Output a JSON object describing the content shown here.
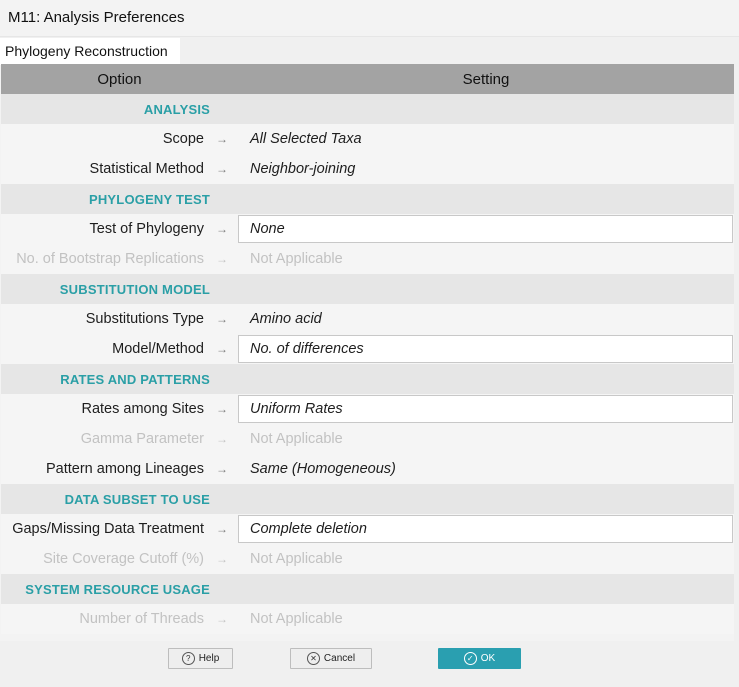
{
  "window": {
    "title": "M11: Analysis Preferences"
  },
  "tabs": [
    {
      "label": "Phylogeny Reconstruction"
    }
  ],
  "grid": {
    "header": {
      "option": "Option",
      "setting": "Setting"
    },
    "arrow_glyph": "→",
    "sections": [
      {
        "label": "ANALYSIS",
        "rows": [
          {
            "option": "Scope",
            "value": "All Selected Taxa",
            "enabled": true,
            "editable": false
          },
          {
            "option": "Statistical Method",
            "value": "Neighbor-joining",
            "enabled": true,
            "editable": false
          }
        ]
      },
      {
        "label": "PHYLOGENY TEST",
        "rows": [
          {
            "option": "Test of Phylogeny",
            "value": "None",
            "enabled": true,
            "editable": true
          },
          {
            "option": "No. of Bootstrap Replications",
            "value": "Not Applicable",
            "enabled": false,
            "editable": false
          }
        ]
      },
      {
        "label": "SUBSTITUTION MODEL",
        "rows": [
          {
            "option": "Substitutions Type",
            "value": "Amino acid",
            "enabled": true,
            "editable": false
          },
          {
            "option": "Model/Method",
            "value": "No. of differences",
            "enabled": true,
            "editable": true
          }
        ]
      },
      {
        "label": "RATES AND PATTERNS",
        "rows": [
          {
            "option": "Rates among Sites",
            "value": "Uniform Rates",
            "enabled": true,
            "editable": true
          },
          {
            "option": "Gamma Parameter",
            "value": "Not Applicable",
            "enabled": false,
            "editable": false
          },
          {
            "option": "Pattern among Lineages",
            "value": "Same (Homogeneous)",
            "enabled": true,
            "editable": false
          }
        ]
      },
      {
        "label": "DATA SUBSET TO USE",
        "rows": [
          {
            "option": "Gaps/Missing Data Treatment",
            "value": "Complete deletion",
            "enabled": true,
            "editable": true
          },
          {
            "option": "Site Coverage Cutoff (%)",
            "value": "Not Applicable",
            "enabled": false,
            "editable": false
          }
        ]
      },
      {
        "label": "SYSTEM RESOURCE USAGE",
        "rows": [
          {
            "option": "Number of Threads",
            "value": "Not Applicable",
            "enabled": false,
            "editable": false
          }
        ]
      }
    ]
  },
  "footer": {
    "help": {
      "label": "Help",
      "icon": "question-icon",
      "glyph": "?"
    },
    "cancel": {
      "label": "Cancel",
      "icon": "close-icon",
      "glyph": "✕"
    },
    "ok": {
      "label": "OK",
      "icon": "check-icon",
      "glyph": "✓"
    }
  },
  "colors": {
    "accent": "#2a9fa6",
    "header_bg": "#a3a3a3",
    "ok_button": "#2a9fb0"
  }
}
